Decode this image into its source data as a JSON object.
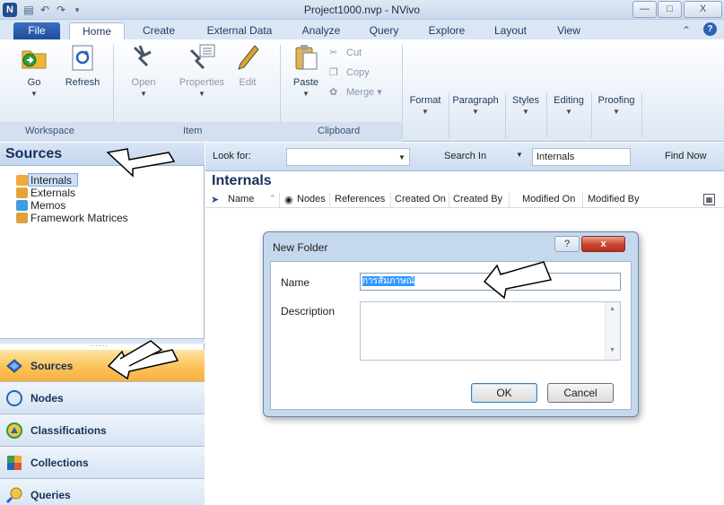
{
  "titlebar": {
    "title": "Project1000.nvp - NVivo",
    "app_logo": "N",
    "quick_access": [
      "save-icon",
      "undo-icon",
      "redo-icon"
    ]
  },
  "tabs": [
    {
      "label": "File"
    },
    {
      "label": "Home"
    },
    {
      "label": "Create"
    },
    {
      "label": "External Data"
    },
    {
      "label": "Analyze"
    },
    {
      "label": "Query"
    },
    {
      "label": "Explore"
    },
    {
      "label": "Layout"
    },
    {
      "label": "View"
    }
  ],
  "ribbon": {
    "workspace": {
      "label": "Workspace",
      "go": "Go",
      "refresh": "Refresh"
    },
    "item": {
      "label": "Item",
      "open": "Open",
      "properties": "Properties",
      "edit": "Edit"
    },
    "clipboard": {
      "label": "Clipboard",
      "paste": "Paste",
      "cut": "Cut",
      "copy": "Copy",
      "merge": "Merge"
    },
    "format": "Format",
    "paragraph": "Paragraph",
    "styles": "Styles",
    "editing": "Editing",
    "proofing": "Proofing"
  },
  "nav": {
    "title": "Sources",
    "tree": [
      {
        "label": "Internals",
        "color": "#f0a93b"
      },
      {
        "label": "Externals",
        "color": "#e8a23a"
      },
      {
        "label": "Memos",
        "color": "#3d9de0"
      },
      {
        "label": "Framework Matrices",
        "color": "#e0a03d"
      }
    ],
    "buttons": [
      {
        "label": "Sources",
        "icon": "sources-icon"
      },
      {
        "label": "Nodes",
        "icon": "nodes-icon"
      },
      {
        "label": "Classifications",
        "icon": "classifications-icon"
      },
      {
        "label": "Collections",
        "icon": "collections-icon"
      },
      {
        "label": "Queries",
        "icon": "queries-icon"
      }
    ]
  },
  "search": {
    "look_for": "Look for:",
    "search_in": "Search In",
    "scope_value": "Internals",
    "find_now": "Find Now"
  },
  "list": {
    "title": "Internals",
    "columns": [
      "Name",
      "Nodes",
      "References",
      "Created On",
      "Created By",
      "Modified On",
      "Modified By"
    ]
  },
  "dialog": {
    "title": "New Folder",
    "help_label": "?",
    "close_label": "x",
    "name_label": "Name",
    "name_value": "การสัมภาษณ์",
    "description_label": "Description",
    "ok": "OK",
    "cancel": "Cancel"
  },
  "colors": {
    "accent": "#1c4e9a",
    "active_nav": "#fbc25a",
    "selection": "#3399ff"
  }
}
